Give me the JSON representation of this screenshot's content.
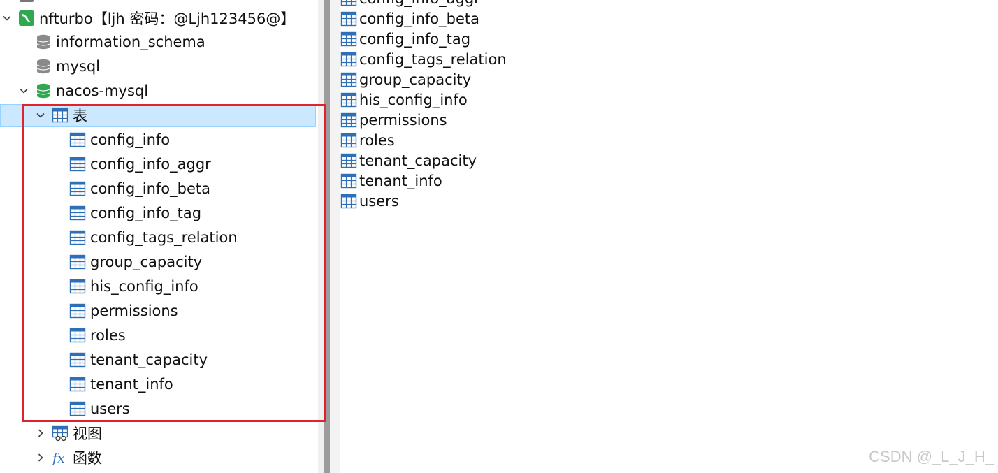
{
  "navigator": {
    "connection": {
      "label": "nfturbo【ljh 密码：@Ljh123456@】",
      "expanded": true
    },
    "databases": [
      {
        "label": "information_schema",
        "expanded": false
      },
      {
        "label": "mysql",
        "expanded": false
      },
      {
        "label": "nacos-mysql",
        "expanded": true
      }
    ],
    "tables_folder": {
      "label": "表",
      "selected": true
    },
    "tables": [
      "config_info",
      "config_info_aggr",
      "config_info_beta",
      "config_info_tag",
      "config_tags_relation",
      "group_capacity",
      "his_config_info",
      "permissions",
      "roles",
      "tenant_capacity",
      "tenant_info",
      "users"
    ],
    "views_folder": {
      "label": "视图"
    },
    "functions_folder": {
      "label": "函数"
    }
  },
  "content": {
    "objects": [
      "config_info_aggr",
      "config_info_beta",
      "config_info_tag",
      "config_tags_relation",
      "group_capacity",
      "his_config_info",
      "permissions",
      "roles",
      "tenant_capacity",
      "tenant_info",
      "users"
    ]
  },
  "watermark": "CSDN @_L_J_H_",
  "colors": {
    "selection": "#cce8ff",
    "highlight_box": "#e0222e",
    "db_active": "#2fa84f",
    "db_inactive": "#8a8a8a",
    "table_icon": "#2e6fb7"
  }
}
